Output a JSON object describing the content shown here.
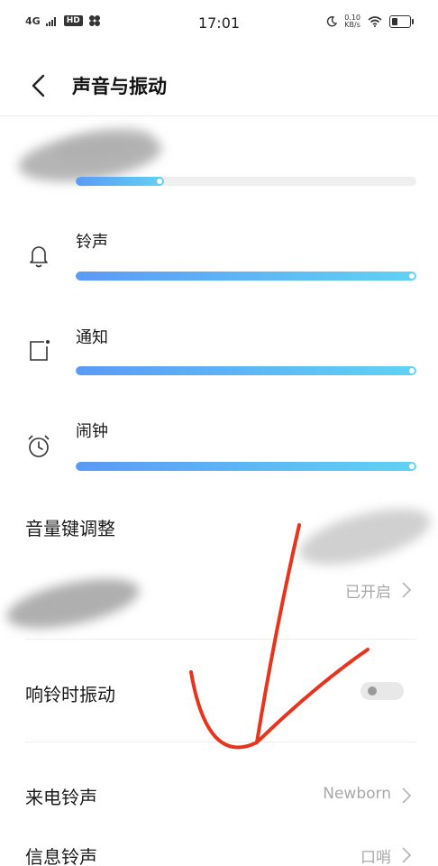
{
  "status_bar": {
    "network": "4G",
    "hd": "HD",
    "time": "17:01",
    "net_speed_value": "0.10",
    "net_speed_unit": "KB/s"
  },
  "header": {
    "title": "声音与振动"
  },
  "volume": {
    "media_level": 0.26,
    "ringtone": {
      "label": "铃声",
      "level": 1.0
    },
    "notification": {
      "label": "通知",
      "level": 1.0
    },
    "alarm": {
      "label": "闹钟",
      "level": 1.0
    }
  },
  "rows": {
    "volume_keys": {
      "label": "音量键调整"
    },
    "hidden_setting": {
      "value": "已开启"
    },
    "vibrate_on_ring": {
      "label": "响铃时振动",
      "enabled": false
    },
    "call_ringtone": {
      "label": "来电铃声",
      "value": "Newborn"
    },
    "message_ringtone": {
      "label": "信息铃声",
      "value": "口哨"
    }
  },
  "colors": {
    "slider_start": "#5b9af6",
    "slider_end": "#60d2f4",
    "annotation": "#e8341c"
  }
}
